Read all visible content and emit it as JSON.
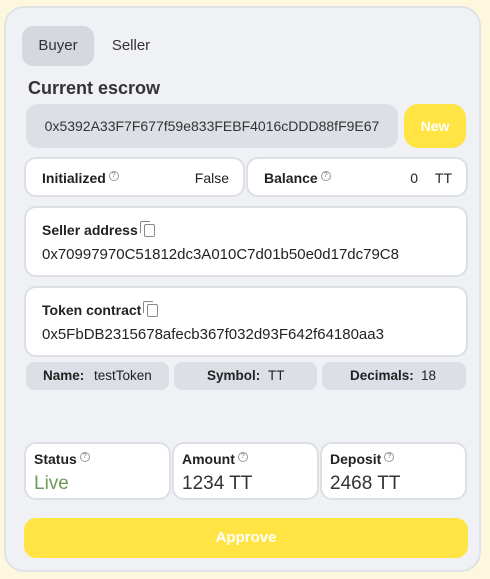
{
  "tabs": [
    {
      "label": "Buyer",
      "active": true
    },
    {
      "label": "Seller",
      "active": false
    }
  ],
  "current_escrow": {
    "heading": "Current escrow",
    "address": "0x5392A33F7F677f59e833FEBF4016cDDD88fF9E67",
    "new_button": "New"
  },
  "initialized": {
    "label": "Initialized",
    "value": "False"
  },
  "balance": {
    "label": "Balance",
    "value": "0",
    "unit": "TT"
  },
  "seller_address": {
    "label": "Seller address",
    "value": "0x70997970C51812dc3A010C7d01b50e0d17dc79C8"
  },
  "token_contract": {
    "label": "Token contract",
    "value": "0x5FbDB2315678afecb367f032d93F642f64180aa3"
  },
  "token_info": {
    "name_label": "Name:",
    "name_value": "testToken",
    "symbol_label": "Symbol:",
    "symbol_value": "TT",
    "decimals_label": "Decimals:",
    "decimals_value": "18"
  },
  "status": {
    "label": "Status",
    "value": "Live"
  },
  "amount": {
    "label": "Amount",
    "value": "1234 TT"
  },
  "deposit": {
    "label": "Deposit",
    "value": "2468 TT"
  },
  "approve_button": "Approve",
  "colors": {
    "accent": "#ffe443",
    "live": "#6e9a5a",
    "panel": "#eff1f4"
  },
  "icons": [
    "help-icon",
    "copy-icon"
  ]
}
